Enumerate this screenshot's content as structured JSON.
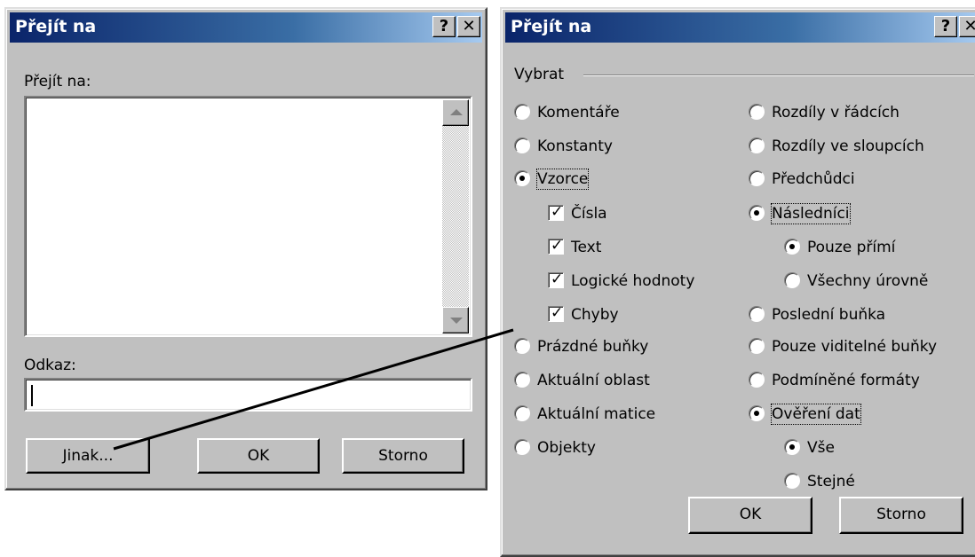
{
  "left_dialog": {
    "title": "Přejít na",
    "help_button": "?",
    "close_button": "✕",
    "goto_label": "Přejít na:",
    "reference_label": "Odkaz:",
    "reference_value": "",
    "special_button": "Jinak...",
    "ok_button": "OK",
    "cancel_button": "Storno"
  },
  "right_dialog": {
    "title": "Přejít na",
    "help_button": "?",
    "close_button": "✕",
    "group_label": "Vybrat",
    "left_column": [
      {
        "label": "Komentáře",
        "type": "radio",
        "checked": false
      },
      {
        "label": "Konstanty",
        "type": "radio",
        "checked": false
      },
      {
        "label": "Vzorce",
        "type": "radio",
        "checked": true
      },
      {
        "label": "Čísla",
        "type": "checkbox",
        "checked": true
      },
      {
        "label": "Text",
        "type": "checkbox",
        "checked": true
      },
      {
        "label": "Logické hodnoty",
        "type": "checkbox",
        "checked": true
      },
      {
        "label": "Chyby",
        "type": "checkbox",
        "checked": true
      },
      {
        "label": "Prázdné buňky",
        "type": "radio",
        "checked": false
      },
      {
        "label": "Aktuální oblast",
        "type": "radio",
        "checked": false
      },
      {
        "label": "Aktuální matice",
        "type": "radio",
        "checked": false
      },
      {
        "label": "Objekty",
        "type": "radio",
        "checked": false
      }
    ],
    "right_column": [
      {
        "label": "Rozdíly v řádcích",
        "type": "radio",
        "checked": false
      },
      {
        "label": "Rozdíly ve sloupcích",
        "type": "radio",
        "checked": false
      },
      {
        "label": "Předchůdci",
        "type": "radio",
        "checked": false
      },
      {
        "label": "Následníci",
        "type": "radio",
        "checked": true
      },
      {
        "label": "Pouze přímí",
        "type": "radio",
        "checked": true
      },
      {
        "label": "Všechny úrovně",
        "type": "radio",
        "checked": false
      },
      {
        "label": "Poslední buňka",
        "type": "radio",
        "checked": false
      },
      {
        "label": "Pouze viditelné buňky",
        "type": "radio",
        "checked": false
      },
      {
        "label": "Podmíněné formáty",
        "type": "radio",
        "checked": false
      },
      {
        "label": "Ověření dat",
        "type": "radio",
        "checked": true
      },
      {
        "label": "Vše",
        "type": "radio",
        "checked": true
      },
      {
        "label": "Stejné",
        "type": "radio",
        "checked": false
      }
    ],
    "ok_button": "OK",
    "cancel_button": "Storno"
  },
  "colors": {
    "dialog_face": "#c0c0c0",
    "titlebar_start": "#0a246a",
    "titlebar_end": "#a6caf0"
  }
}
